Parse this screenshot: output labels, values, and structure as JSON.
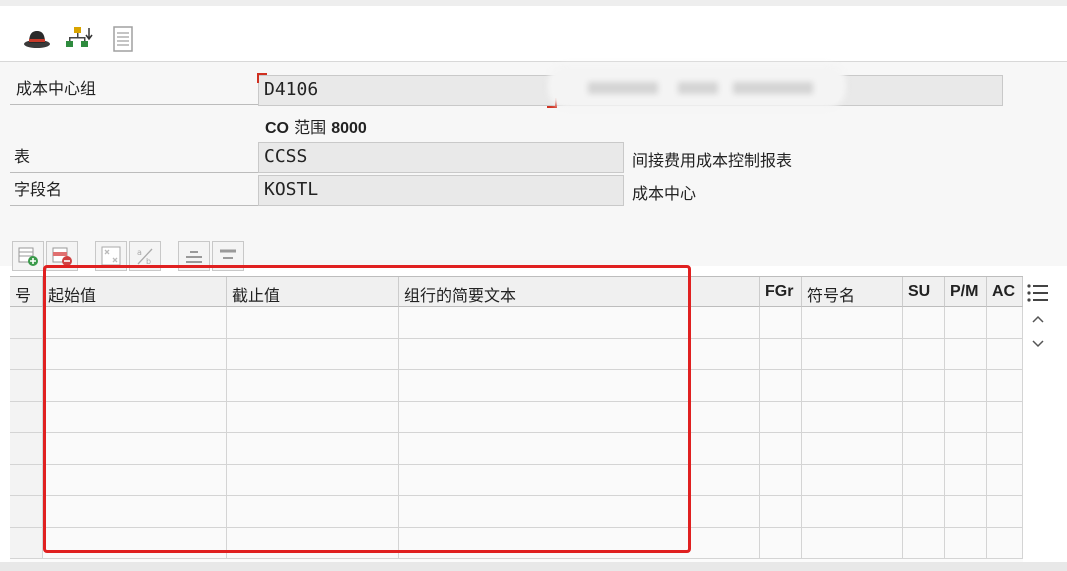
{
  "toolbar": {
    "icons": [
      "hat-icon",
      "hierarchy-icon",
      "document-icon"
    ]
  },
  "form": {
    "cost_center_group": {
      "label": "成本中心组",
      "value": "D4106"
    },
    "co_area": {
      "prefix": "CO",
      "label": "范围",
      "value": "8000"
    },
    "table": {
      "label": "表",
      "value": "CCSS",
      "description": "间接费用成本控制报表"
    },
    "field_name": {
      "label": "字段名",
      "value": "KOSTL",
      "description": "成本中心"
    }
  },
  "grid": {
    "columns": [
      "号",
      "起始值",
      "截止值",
      "组行的简要文本",
      "FGr",
      "符号名",
      "SU",
      "P/M",
      "AC"
    ],
    "row_count": 8
  },
  "colors": {
    "highlight_box": "#e02020",
    "focus_corner": "#d03020"
  }
}
